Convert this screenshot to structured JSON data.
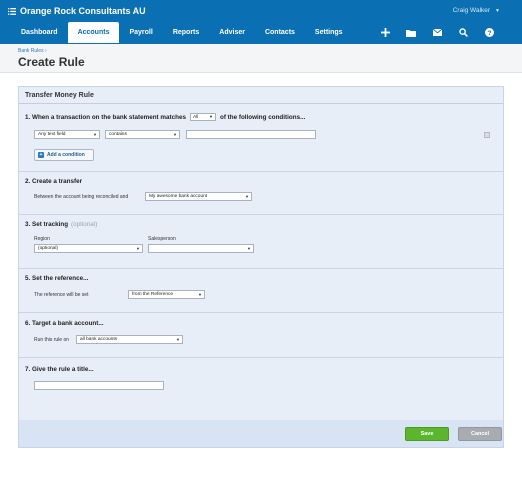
{
  "header": {
    "org_name": "Orange Rock Consultants AU",
    "user_name": "Craig Walker",
    "nav": [
      "Dashboard",
      "Accounts",
      "Payroll",
      "Reports",
      "Adviser",
      "Contacts",
      "Settings"
    ],
    "active_nav": "Accounts",
    "icons": [
      "plus-icon",
      "folder-icon",
      "mail-icon",
      "search-icon",
      "help-icon"
    ]
  },
  "page": {
    "breadcrumb": "Bank Rules ›",
    "title": "Create Rule"
  },
  "form": {
    "panel_title": "Transfer Money Rule",
    "s1": {
      "title_a": "1.  When a transaction on the bank statement matches",
      "match_value": "All",
      "title_b": "of the following conditions...",
      "field_value": "Any text field",
      "operator_value": "contains",
      "condition_text": "",
      "add_condition": "Add a condition"
    },
    "s2": {
      "title": "2.  Create a transfer",
      "label": "Between the account being reconciled and",
      "account_value": "My awesome bank account"
    },
    "s3": {
      "title": "3.  Set tracking",
      "optional": "(optional)",
      "region_label": "Region",
      "region_value": "(optional)",
      "salesperson_label": "Salesperson",
      "salesperson_value": ""
    },
    "s5": {
      "title": "5.  Set the reference...",
      "label": "The reference will be set",
      "value": "from the Reference"
    },
    "s6": {
      "title": "6.  Target a bank account...",
      "label": "Run this rule on",
      "value": "all bank accounts"
    },
    "s7": {
      "title": "7.  Give the rule a title...",
      "value": ""
    },
    "buttons": {
      "save": "Save",
      "cancel": "Cancel"
    }
  },
  "colors": {
    "header_bg": "#0a6fb3",
    "panel_bg": "#e7eef8",
    "save_green": "#5bb52d",
    "cancel_grey": "#a8acb0",
    "link_blue": "#2a7ac3"
  }
}
